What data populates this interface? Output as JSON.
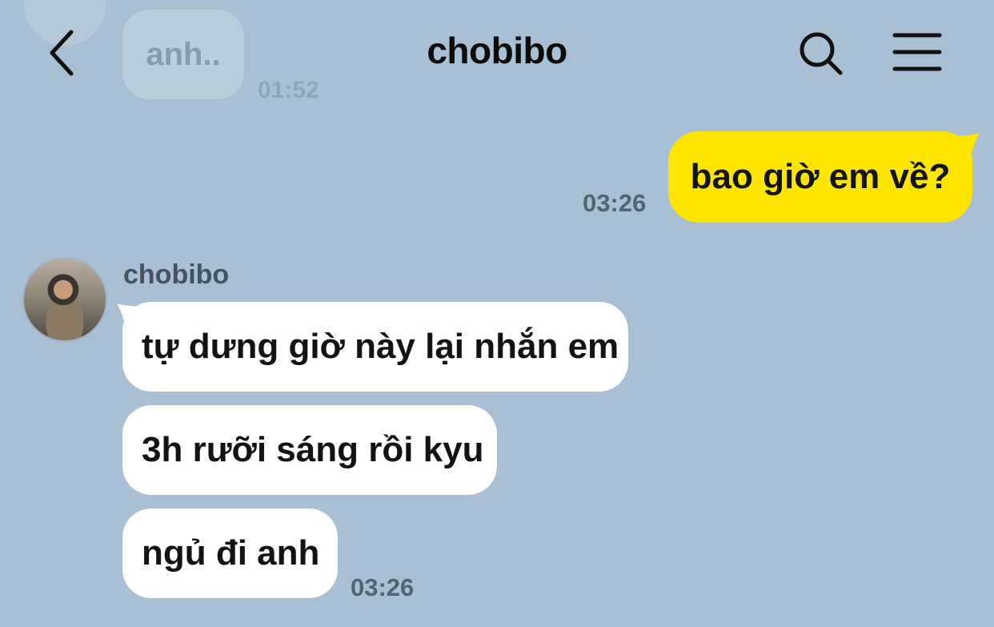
{
  "header": {
    "title": "chobibo",
    "back_icon": "chevron-left-icon",
    "search_icon": "search-icon",
    "menu_icon": "hamburger-menu-icon"
  },
  "previous_message": {
    "text": "anh..",
    "time": "01:52"
  },
  "outgoing": {
    "text": "bao giờ em về?",
    "time": "03:26",
    "bubble_color": "#fee500"
  },
  "incoming": {
    "sender": "chobibo",
    "messages": [
      "tự dưng giờ này lại nhắn em",
      "3h rưỡi sáng rồi kyu",
      "ngủ đi anh"
    ],
    "time": "03:26",
    "bubble_color": "#ffffff"
  },
  "colors": {
    "background": "#a9bfd3",
    "text": "#131313",
    "timestamp": "#55636f"
  }
}
